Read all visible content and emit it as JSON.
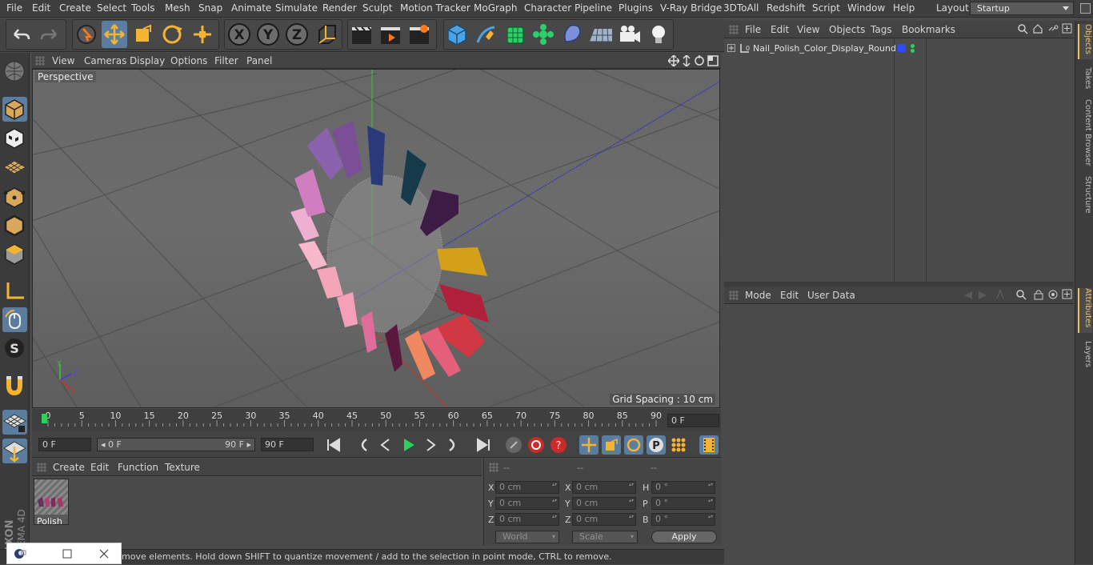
{
  "menu": {
    "items": [
      "File",
      "Edit",
      "Create",
      "Select",
      "Tools",
      "Mesh",
      "Snap",
      "Animate",
      "Simulate",
      "Render",
      "Sculpt",
      "Motion Tracker",
      "MoGraph",
      "Character",
      "Pipeline",
      "Plugins",
      "V-Ray Bridge",
      "3DToAll",
      "Redshift",
      "Script",
      "Window",
      "Help"
    ],
    "layout_label": "Layout:",
    "layout_value": "Startup"
  },
  "toolbar": {
    "icons": [
      "undo-icon",
      "redo-icon",
      "live-selection-icon",
      "move-icon",
      "scale-icon",
      "rotate-icon",
      "recent-tool-icon",
      "x-axis-icon",
      "y-axis-icon",
      "z-axis-icon",
      "coordinate-system-icon",
      "render-view-icon",
      "render-to-picture-viewer-icon",
      "edit-render-settings-icon",
      "cube-icon",
      "pen-icon",
      "subdivision-icon",
      "cloner-icon",
      "deformer-icon",
      "floor-icon",
      "camera-icon",
      "light-icon"
    ],
    "axis_x": "X",
    "axis_y": "Y",
    "axis_z": "Z"
  },
  "viewport": {
    "menu": [
      "View",
      "Cameras",
      "Display",
      "Options",
      "Filter",
      "Panel"
    ],
    "label": "Perspective",
    "grid_spacing": "Grid Spacing : 10 cm"
  },
  "timeline": {
    "ticks": [
      "0",
      "5",
      "10",
      "15",
      "20",
      "25",
      "30",
      "35",
      "40",
      "45",
      "50",
      "55",
      "60",
      "65",
      "70",
      "75",
      "80",
      "85",
      "90"
    ],
    "current_frame": "0 F",
    "start_field": "0 F",
    "range_start": "◂ 0 F",
    "range_end": "90 F ▸",
    "end_field": "90 F"
  },
  "materials": {
    "menu": [
      "Create",
      "Edit",
      "Function",
      "Texture"
    ],
    "items": [
      {
        "name": "Polish"
      }
    ]
  },
  "coords": {
    "headers": [
      "--",
      "--",
      "--"
    ],
    "rows": [
      {
        "a": "X",
        "av": "0 cm",
        "b": "X",
        "bv": "0 cm",
        "c": "H",
        "cv": "0 °"
      },
      {
        "a": "Y",
        "av": "0 cm",
        "b": "Y",
        "bv": "0 cm",
        "c": "P",
        "cv": "0 °"
      },
      {
        "a": "Z",
        "av": "0 cm",
        "b": "Z",
        "bv": "0 cm",
        "c": "B",
        "cv": "0 °"
      }
    ],
    "mode_world": "World",
    "mode_scale": "Scale",
    "apply": "Apply"
  },
  "objects": {
    "menu": [
      "File",
      "Edit",
      "View",
      "Objects",
      "Tags",
      "Bookmarks"
    ],
    "items": [
      {
        "name": "Nail_Polish_Color_Display_Round"
      }
    ]
  },
  "attributes": {
    "menu": [
      "Mode",
      "Edit",
      "User Data"
    ]
  },
  "side_tabs": [
    "Objects",
    "Takes",
    "Content Browser",
    "Structure",
    "Attributes",
    "Layers"
  ],
  "status": "move elements. Hold down SHIFT to quantize movement / add to the selection in point mode, CTRL to remove.",
  "branding": {
    "maxon": "MAXON",
    "cinema": "CINEMA 4D"
  },
  "colors": {
    "accent_active": "#5b7ea0",
    "tab_active": "#f1c15a",
    "bg": "#4a4a4a"
  }
}
